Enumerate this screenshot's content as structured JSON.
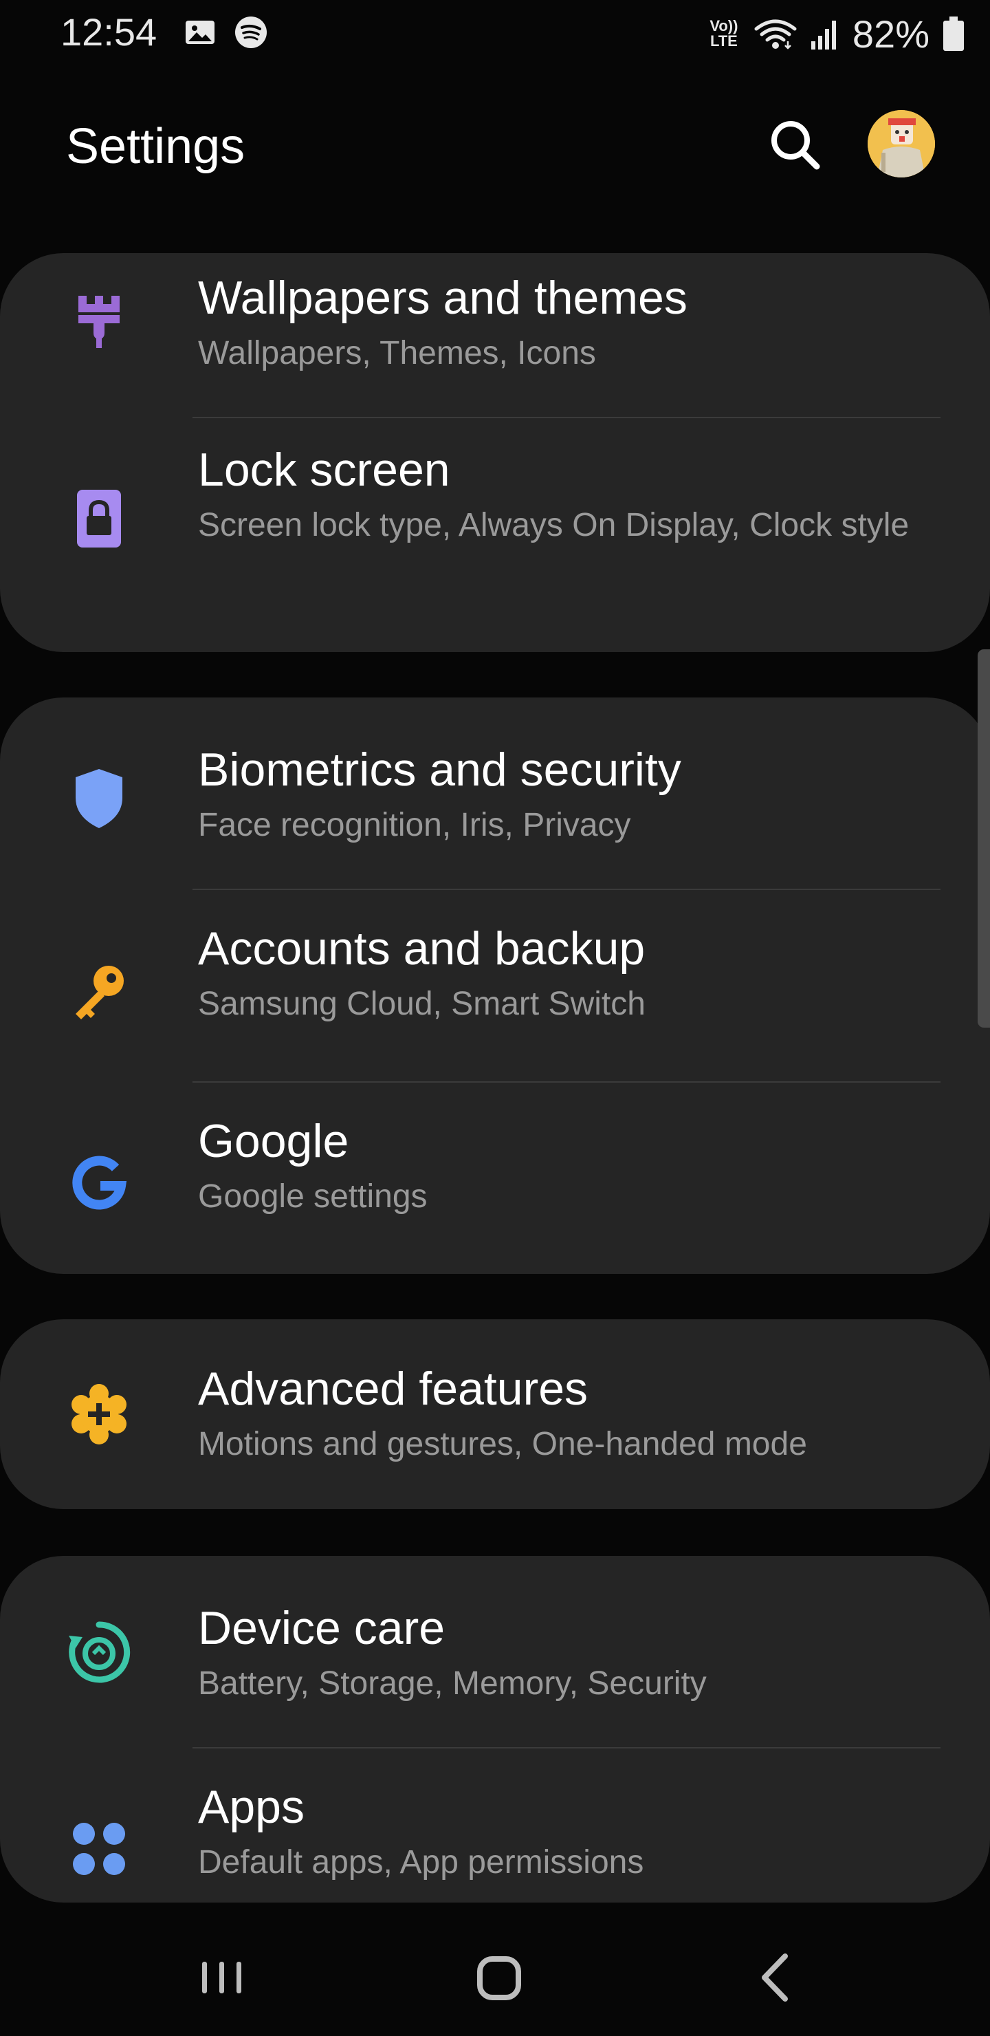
{
  "status_bar": {
    "time": "12:54",
    "volte_line1": "Vo))",
    "volte_line2": "LTE",
    "battery_percent": "82%",
    "icons": [
      "gallery-icon",
      "spotify-icon",
      "volte-icon",
      "wifi-icon",
      "signal-icon",
      "battery-icon"
    ]
  },
  "header": {
    "title": "Settings"
  },
  "cards": [
    {
      "items": [
        {
          "title": "Wallpapers and themes",
          "subtitle": "Wallpapers, Themes, Icons",
          "icon": "paintbrush-icon",
          "color": "#9b6bd6"
        },
        {
          "title": "Lock screen",
          "subtitle": "Screen lock type, Always On Display, Clock style",
          "icon": "lock-icon",
          "color": "#a78bf0"
        }
      ]
    },
    {
      "items": [
        {
          "title": "Biometrics and security",
          "subtitle": "Face recognition, Iris, Privacy",
          "icon": "shield-icon",
          "color": "#7aa2f7"
        },
        {
          "title": "Accounts and backup",
          "subtitle": "Samsung Cloud, Smart Switch",
          "icon": "key-icon",
          "color": "#f5a623"
        },
        {
          "title": "Google",
          "subtitle": "Google settings",
          "icon": "google-icon",
          "color": "#4285f4"
        }
      ]
    },
    {
      "items": [
        {
          "title": "Advanced features",
          "subtitle": "Motions and gestures, One-handed mode",
          "icon": "advanced-gear-icon",
          "color": "#f5b325"
        }
      ]
    },
    {
      "items": [
        {
          "title": "Device care",
          "subtitle": "Battery, Storage, Memory, Security",
          "icon": "device-care-icon",
          "color": "#3cc6a8"
        },
        {
          "title": "Apps",
          "subtitle": "Default apps, App permissions",
          "icon": "apps-icon",
          "color": "#6a9cf2"
        }
      ]
    }
  ],
  "nav_bar": {
    "buttons": [
      "recents-button",
      "home-button",
      "back-button"
    ]
  }
}
